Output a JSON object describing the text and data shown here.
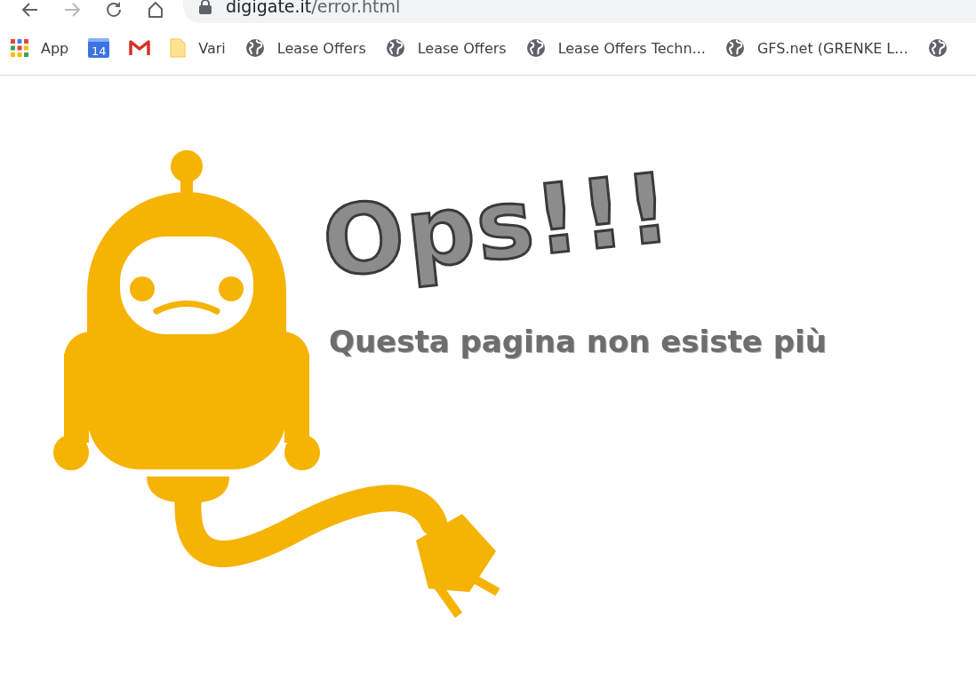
{
  "toolbar": {
    "buttons": [
      {
        "kind": "back",
        "disabled": false
      },
      {
        "kind": "forward",
        "disabled": true
      },
      {
        "kind": "reload",
        "disabled": false
      },
      {
        "kind": "home",
        "disabled": false
      }
    ],
    "address": {
      "host": "digigate.it",
      "path": "/error.html"
    }
  },
  "bookmarks": [
    {
      "kind": "apps",
      "label": "App"
    },
    {
      "kind": "calendar",
      "icon_text": "14"
    },
    {
      "kind": "gmail"
    },
    {
      "kind": "folder",
      "label": "Vari"
    },
    {
      "kind": "globe",
      "label": "Lease Offers"
    },
    {
      "kind": "globe",
      "label": "Lease Offers"
    },
    {
      "kind": "globe",
      "label": "Lease Offers Techn..."
    },
    {
      "kind": "globe",
      "label": "GFS.net (GRENKE L..."
    },
    {
      "kind": "globe"
    }
  ],
  "message": {
    "title": "Ops!!!",
    "subtitle": "Questa pagina non esiste più"
  }
}
